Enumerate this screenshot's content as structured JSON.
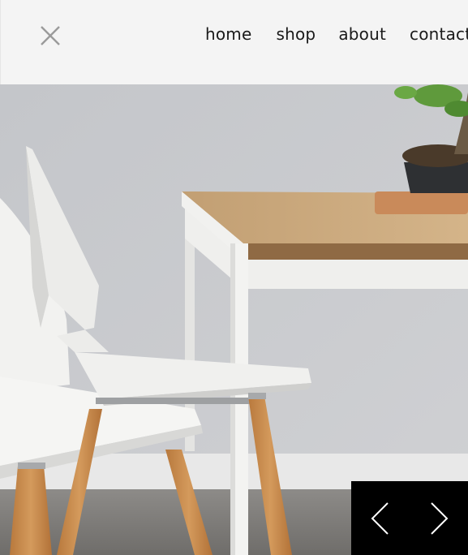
{
  "header": {
    "close_icon": "close-icon",
    "nav": [
      {
        "label": "home"
      },
      {
        "label": "shop"
      },
      {
        "label": "about"
      },
      {
        "label": "contact"
      }
    ]
  },
  "hero": {
    "image": "photo of white chairs with wooden legs beside a white table with a bonsai plant",
    "colors": {
      "wall": "#c9cbcf",
      "table_top": "#c9a77a",
      "chair": "#ecece9",
      "wood_leg": "#c58a4e"
    }
  },
  "slider": {
    "prev_icon": "chevron-left-icon",
    "next_icon": "chevron-right-icon"
  }
}
